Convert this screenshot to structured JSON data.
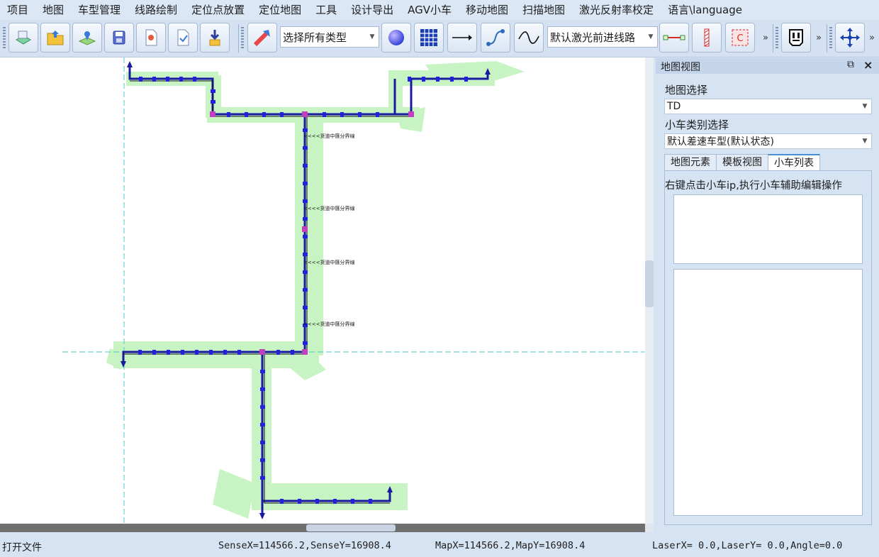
{
  "menu": [
    "项目",
    "地图",
    "车型管理",
    "线路绘制",
    "定位点放置",
    "定位地图",
    "工具",
    "设计导出",
    "AGV小车",
    "移动地图",
    "扫描地图",
    "激光反射率校定",
    "语言\\language"
  ],
  "toolbar": {
    "type_filter": "选择所有类型",
    "path_mode": "默认激光前进线路",
    "overflow": "»"
  },
  "canvas": {
    "annotations": [
      "<<<<货道中匯分界缐",
      "<<<<货道中匯分界缐",
      "<<<<货道中匯分界缐",
      "<<<<货道中匯分界缐"
    ]
  },
  "panel": {
    "title": "地图视图",
    "map_select_label": "地图选择",
    "map_select_value": "TD",
    "vehicle_type_label": "小车类别选择",
    "vehicle_type_value": "默认差速车型(默认状态)",
    "tabs": [
      "地图元素",
      "模板视图",
      "小车列表"
    ],
    "active_tab": "小车列表",
    "hint": "右键点击小车ip,执行小车辅助编辑操作"
  },
  "status": {
    "left": "打开文件",
    "sense": "SenseX=114566.2,SenseY=16908.4",
    "map": "MapX=114566.2,MapY=16908.4",
    "laser": "LaserX=   0.0,LaserY=   0.0,Angle=0.0"
  },
  "colors": {
    "accent": "#4a8fd4",
    "path": "#1a1aa0",
    "node": "#2222dd",
    "scan": "#b6f0b0",
    "guide": "#50c8c8"
  }
}
